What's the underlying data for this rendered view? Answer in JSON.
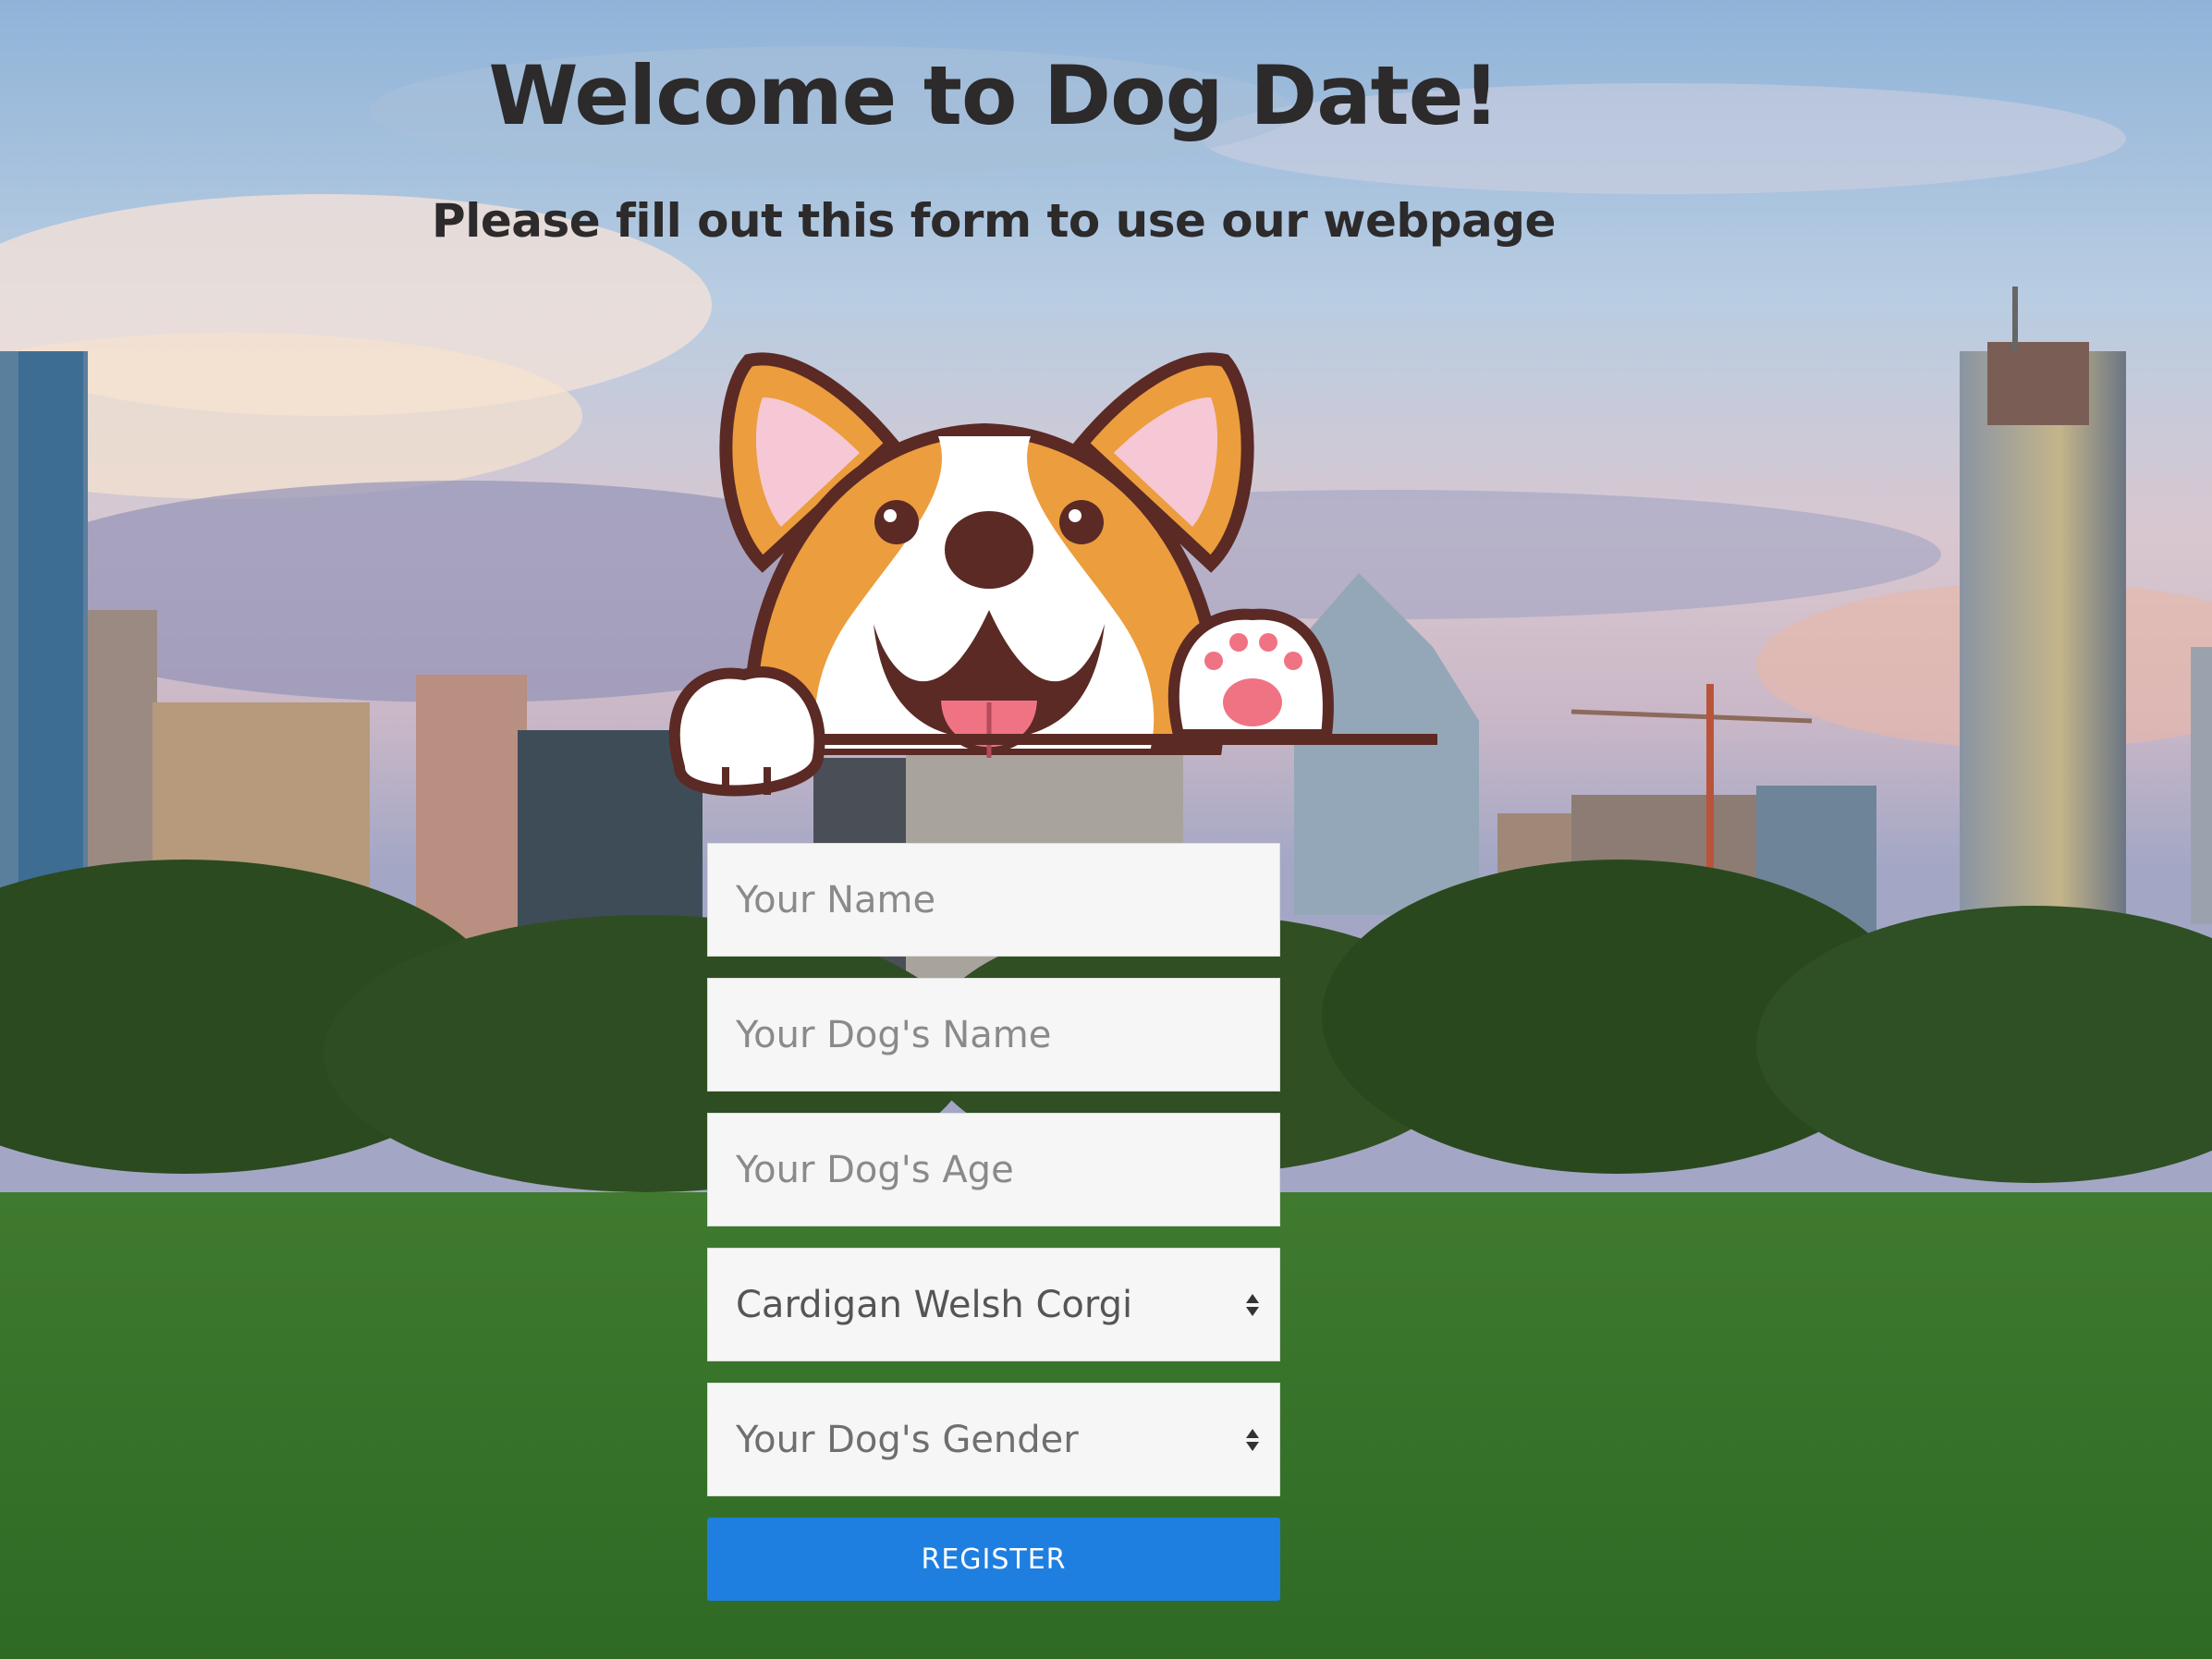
{
  "header": {
    "title": "Welcome to Dog Date!",
    "subtitle": "Please fill out this form to use our webpage"
  },
  "form": {
    "name_placeholder": "Your Name",
    "dog_name_placeholder": "Your Dog's Name",
    "dog_age_placeholder": "Your Dog's Age",
    "breed_selected": "Cardigan Welsh Corgi",
    "gender_selected": "Your Dog's Gender",
    "register_label": "REGISTER"
  },
  "colors": {
    "button": "#1f7fe0",
    "title_text": "#2c2a2a",
    "field_bg": "#f6f6f6"
  },
  "icons": {
    "mascot": "corgi-mascot-icon",
    "select_arrows": "select-arrows-icon"
  }
}
